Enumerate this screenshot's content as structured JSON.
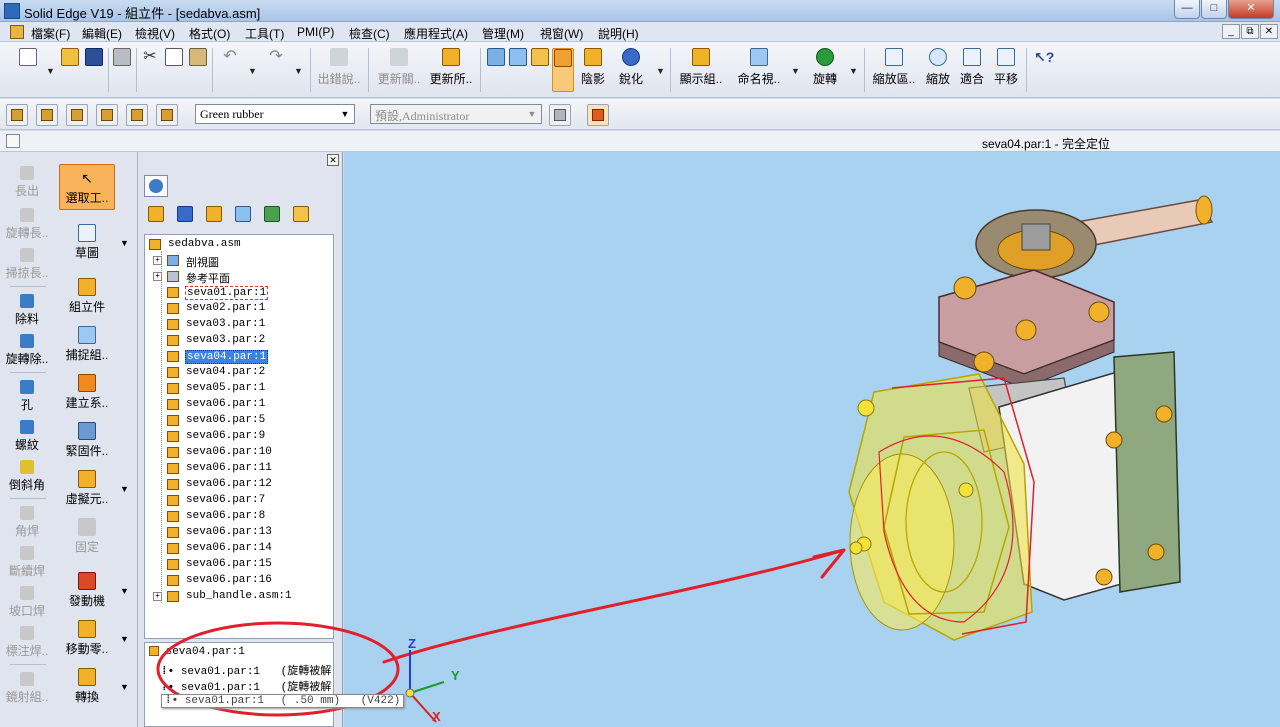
{
  "window": {
    "title": "Solid Edge V19 - 組立件 - [sedabva.asm]",
    "min": "—",
    "max": "□",
    "close": "✕"
  },
  "menu": [
    "檔案(F)",
    "編輯(E)",
    "檢視(V)",
    "格式(O)",
    "工具(T)",
    "PMI(P)",
    "檢查(C)",
    "應用程式(A)",
    "管理(M)",
    "視窗(W)",
    "說明(H)"
  ],
  "mdi": {
    "min": "_",
    "restore": "⧉",
    "close": "✕"
  },
  "toolbar": {
    "update_links": "出錯說..",
    "update_rel": "更新關..",
    "update_all": "更新所..",
    "shading": "陰影",
    "sharpen": "銳化",
    "display_comp": "顯示組..",
    "named_views": "命名視..",
    "rotate": "旋轉",
    "zoom_area": "縮放區..",
    "zoom": "縮放",
    "fit": "適合",
    "pan": "平移"
  },
  "toolbar2": {
    "material": "Green rubber",
    "user": "預設,Administrator"
  },
  "status": {
    "text": "seva04.par:1 - 完全定位"
  },
  "features": {
    "extrude": "長出",
    "revolve": "旋轉長..",
    "sweep": "掃掠長..",
    "cutout": "除料",
    "revolve_cut": "旋轉除..",
    "hole": "孔",
    "thread": "螺紋",
    "chamfer": "倒斜角",
    "fillet_weld": "角焊",
    "stitch_weld": "斷續焊",
    "groove_weld": "坡口焊",
    "weld_label": "標注焊..",
    "mirror": "鏡射組..",
    "select": "選取工..",
    "sketch": "草圖",
    "assemble": "組立件",
    "capture": "捕捉組..",
    "create_sys": "建立系..",
    "fasteners": "緊固件..",
    "virtual": "虛擬元..",
    "fix": "固定",
    "motor": "發動機",
    "move": "移動零..",
    "transform": "轉換"
  },
  "tree": {
    "root": "sedabva.asm",
    "nodes": [
      {
        "label": "剖視圖",
        "type": "folder",
        "expand": "+"
      },
      {
        "label": "參考平面",
        "type": "plane",
        "expand": "+"
      },
      {
        "label": "seva01.par:1",
        "type": "part",
        "state": "dashed"
      },
      {
        "label": "seva02.par:1",
        "type": "part"
      },
      {
        "label": "seva03.par:1",
        "type": "part"
      },
      {
        "label": "seva03.par:2",
        "type": "part"
      },
      {
        "label": "seva04.par:1",
        "type": "part",
        "state": "selected"
      },
      {
        "label": "seva04.par:2",
        "type": "part"
      },
      {
        "label": "seva05.par:1",
        "type": "part"
      },
      {
        "label": "seva06.par:1",
        "type": "part"
      },
      {
        "label": "seva06.par:5",
        "type": "part"
      },
      {
        "label": "seva06.par:9",
        "type": "part"
      },
      {
        "label": "seva06.par:10",
        "type": "part"
      },
      {
        "label": "seva06.par:11",
        "type": "part"
      },
      {
        "label": "seva06.par:12",
        "type": "part"
      },
      {
        "label": "seva06.par:7",
        "type": "part"
      },
      {
        "label": "seva06.par:8",
        "type": "part"
      },
      {
        "label": "seva06.par:13",
        "type": "part"
      },
      {
        "label": "seva06.par:14",
        "type": "part"
      },
      {
        "label": "seva06.par:15",
        "type": "part"
      },
      {
        "label": "seva06.par:16",
        "type": "part"
      },
      {
        "label": "sub_handle.asm:1",
        "type": "asm",
        "expand": "+"
      }
    ]
  },
  "relationships": {
    "header": "seva04.par:1",
    "rows": [
      {
        "part": "seva01.par:1",
        "detail": "(旋轉被解"
      },
      {
        "part": "seva01.par:1",
        "detail": "(旋轉被解"
      },
      {
        "part": "seva01.par:1",
        "detail": "( .50 mm)",
        "extra": "(V422)"
      }
    ]
  },
  "triad": {
    "x": "X",
    "y": "Y",
    "z": "Z"
  },
  "colors": {
    "viewport_bg": "#a8d2f0",
    "accent_orange": "#f7b25a",
    "annotation_red": "#e0202a",
    "highlight_yellow": "#f2e23a"
  }
}
